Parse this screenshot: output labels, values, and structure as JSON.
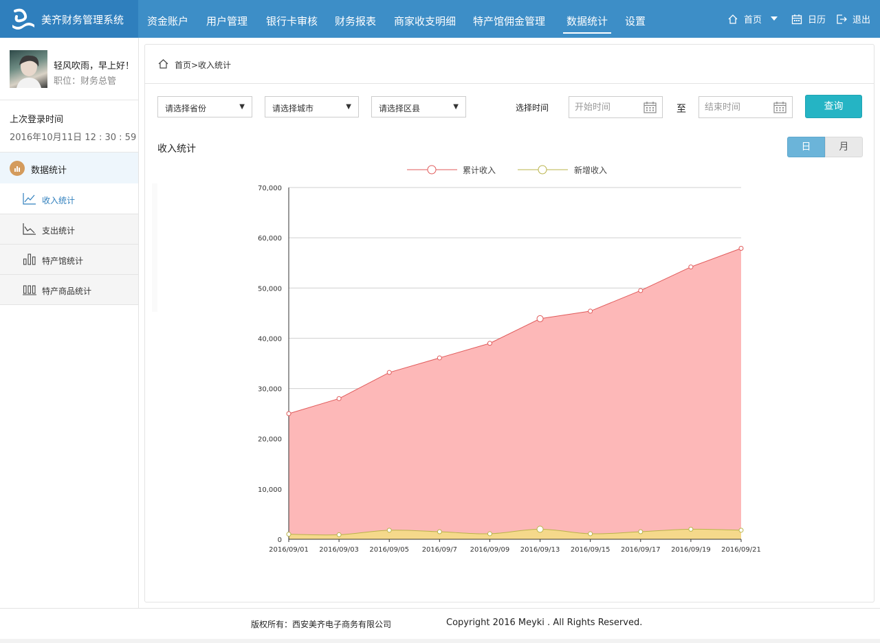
{
  "app": {
    "title": "美齐财务管理系统"
  },
  "nav": {
    "items": [
      {
        "label": "资金账户"
      },
      {
        "label": "用户管理"
      },
      {
        "label": "银行卡审核"
      },
      {
        "label": "财务报表"
      },
      {
        "label": "商家收支明细"
      },
      {
        "label": "特产馆佣金管理"
      },
      {
        "label": "数据统计",
        "active": true
      },
      {
        "label": "设置"
      }
    ],
    "home_label": "首页",
    "calendar_label": "日历",
    "logout_label": "退出"
  },
  "user": {
    "greeting": "轻风吹雨，早上好！",
    "role": "职位：财务总管",
    "last_login_label": "上次登录时间",
    "last_login_value": "2016年10月11日    12 : 30 : 59"
  },
  "sidebar": {
    "section_label": "数据统计",
    "items": [
      {
        "label": "收入统计",
        "icon": "line-chart-icon",
        "active": true
      },
      {
        "label": "支出统计",
        "icon": "decline-chart-icon"
      },
      {
        "label": "特产馆统计",
        "icon": "bar-chart-icon"
      },
      {
        "label": "特产商品统计",
        "icon": "bar-chart-icon"
      }
    ]
  },
  "breadcrumb": {
    "text": "首页>收入统计"
  },
  "filters": {
    "province": "请选择省份",
    "city": "请选择城市",
    "district": "请选择区县",
    "time_label": "选择时间",
    "start_placeholder": "开始时间",
    "to_label": "至",
    "end_placeholder": "结束时间",
    "query_label": "查询"
  },
  "section": {
    "title": "收入统计",
    "day_label": "日",
    "month_label": "月"
  },
  "colors": {
    "topbar": "#3d8ec7",
    "accent": "#25b4c4",
    "cumulative_fill": "#fdb8b8",
    "cumulative_line": "#e05a5a",
    "new_fill": "#f5d98b",
    "new_line": "#b9b34a"
  },
  "chart_data": {
    "type": "area",
    "categories": [
      "2016/09/01",
      "2016/09/03",
      "2016/09/05",
      "2016/09/7",
      "2016/09/09",
      "2016/09/13",
      "2016/09/15",
      "2016/09/17",
      "2016/09/19",
      "2016/09/21"
    ],
    "series": [
      {
        "name": "累计收入",
        "values": [
          25000,
          28000,
          33200,
          36100,
          39000,
          43900,
          45400,
          49500,
          54200,
          57900
        ]
      },
      {
        "name": "新增收入",
        "values": [
          1000,
          900,
          1800,
          1500,
          1100,
          2000,
          1100,
          1500,
          2000,
          1800
        ]
      }
    ],
    "ylim": [
      0,
      70000
    ],
    "yticks": [
      "0",
      "10,000",
      "20,000",
      "30,000",
      "40,000",
      "50,000",
      "60,000",
      "70,000"
    ],
    "legend": "top-center",
    "grid": true
  },
  "footer": {
    "company": "版权所有：西安美齐电子商务有限公司",
    "copyright": "Copyright 2016 Meyki . All Rights Reserved."
  }
}
